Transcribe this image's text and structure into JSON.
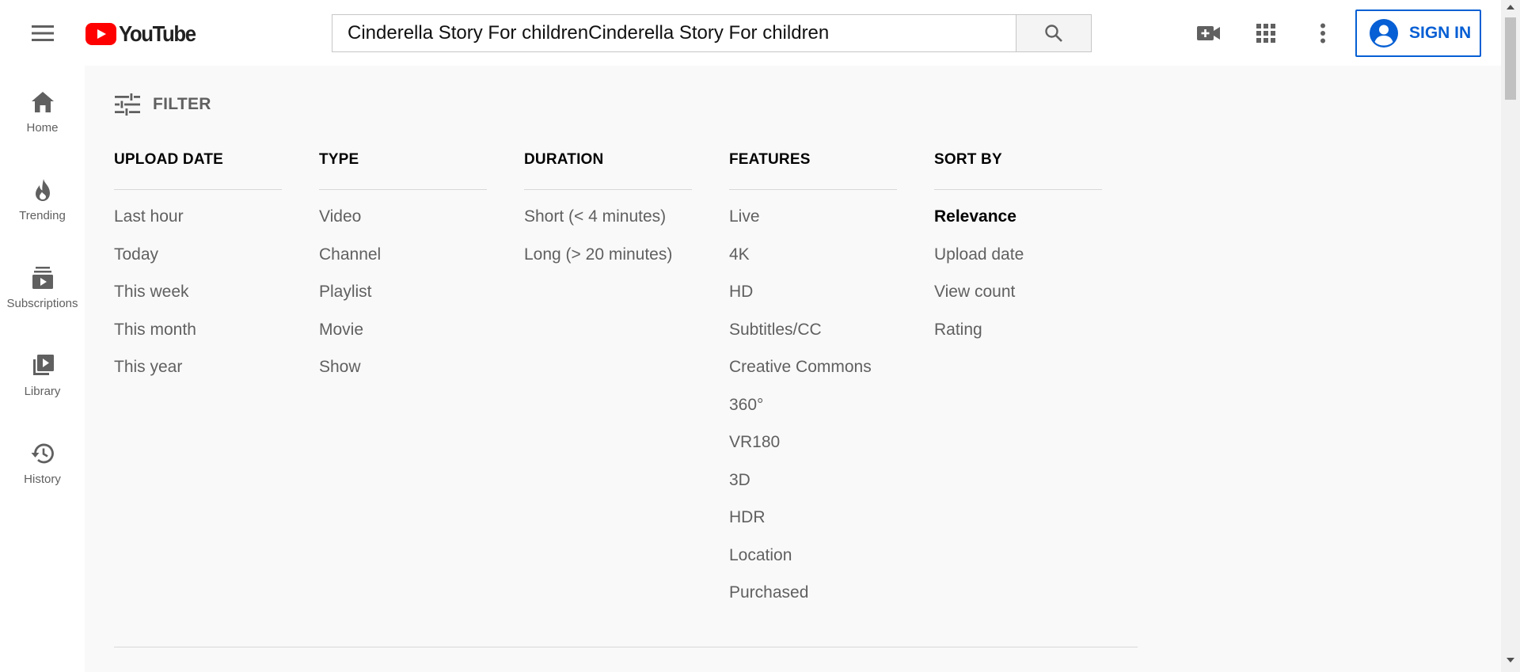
{
  "header": {
    "logo_text": "YouTube",
    "search_value": "Cinderella Story For childrenCinderella Story For children",
    "signin_label": "SIGN IN"
  },
  "sidebar": {
    "items": [
      {
        "label": "Home",
        "icon": "home-icon"
      },
      {
        "label": "Trending",
        "icon": "trending-icon"
      },
      {
        "label": "Subscriptions",
        "icon": "subscriptions-icon"
      },
      {
        "label": "Library",
        "icon": "library-icon"
      },
      {
        "label": "History",
        "icon": "history-icon"
      }
    ]
  },
  "filter": {
    "toggle_label": "FILTER",
    "columns": [
      {
        "title": "UPLOAD DATE",
        "options": [
          "Last hour",
          "Today",
          "This week",
          "This month",
          "This year"
        ]
      },
      {
        "title": "TYPE",
        "options": [
          "Video",
          "Channel",
          "Playlist",
          "Movie",
          "Show"
        ]
      },
      {
        "title": "DURATION",
        "options": [
          "Short (< 4 minutes)",
          "Long (> 20 minutes)"
        ]
      },
      {
        "title": "FEATURES",
        "options": [
          "Live",
          "4K",
          "HD",
          "Subtitles/CC",
          "Creative Commons",
          "360°",
          "VR180",
          "3D",
          "HDR",
          "Location",
          "Purchased"
        ]
      },
      {
        "title": "SORT BY",
        "options": [
          "Relevance",
          "Upload date",
          "View count",
          "Rating"
        ],
        "selected": "Relevance"
      }
    ]
  },
  "colors": {
    "brand_red": "#ff0000",
    "accent_blue": "#065fd4",
    "text_secondary": "#606060"
  }
}
